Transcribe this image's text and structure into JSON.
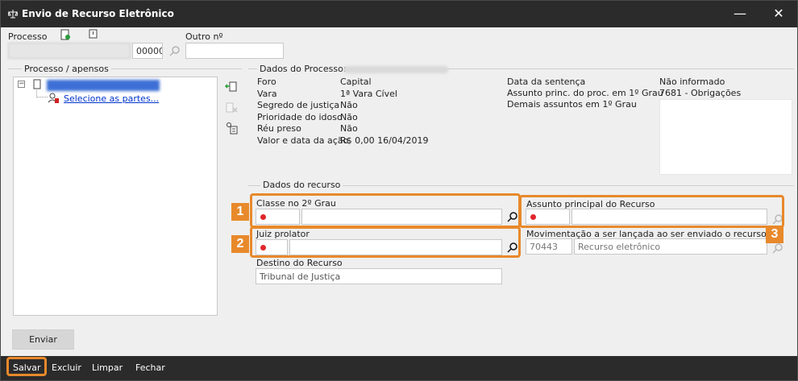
{
  "window": {
    "title": "Envio de Recurso Eletrônico"
  },
  "top": {
    "processo_label": "Processo",
    "processo_suffix": "00000",
    "outro_label": "Outro nº"
  },
  "left_panel": {
    "legend": "Processo / apensos",
    "tree_link": "Selecione as partes..."
  },
  "dados_processo": {
    "legend": "Dados do Processo:",
    "fields": [
      {
        "label": "Foro",
        "value": "Capital"
      },
      {
        "label": "Vara",
        "value": "1ª Vara Cível"
      },
      {
        "label": "Segredo de justiça",
        "value": "Não"
      },
      {
        "label": "Prioridade do idoso",
        "value": "Não"
      },
      {
        "label": "Réu preso",
        "value": "Não"
      },
      {
        "label": "Valor e data da ação",
        "value": "R$ 0,00 16/04/2019"
      }
    ],
    "right_fields": [
      {
        "label": "Data da sentença",
        "value": "Não informado"
      },
      {
        "label": "Assunto princ. do proc. em 1º Grau",
        "value": "7681 - Obrigações"
      },
      {
        "label": "Demais assuntos em 1º Grau",
        "value": ""
      }
    ]
  },
  "dados_recurso": {
    "legend": "Dados do recurso",
    "classe_label": "Classe no 2º Grau",
    "juiz_label": "Juiz prolator",
    "destino_label": "Destino do Recurso",
    "destino_value": "Tribunal de Justiça",
    "assunto_label": "Assunto principal do Recurso",
    "movimentacao_label": "Movimentação a ser lançada ao ser enviado o recurso",
    "movimentacao_code": "70443",
    "movimentacao_desc": "Recurso eletrônico"
  },
  "badges": [
    "1",
    "2",
    "3"
  ],
  "buttons": {
    "enviar": "Enviar"
  },
  "bottom_bar": {
    "salvar": "Salvar",
    "excluir": "Excluir",
    "limpar": "Limpar",
    "fechar": "Fechar"
  },
  "colors": {
    "highlight": "#e8892b",
    "titlebar": "#2b2b2b",
    "required": "#e0272b",
    "link": "#0033cc"
  }
}
